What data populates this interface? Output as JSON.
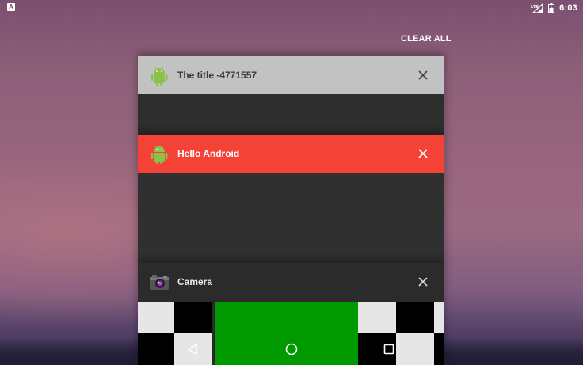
{
  "status_bar": {
    "notification_icon": "A",
    "signal_label": "LTE",
    "time": "6:03"
  },
  "recents": {
    "clear_all_label": "CLEAR ALL",
    "tasks": [
      {
        "title": "The title -4771557",
        "icon": "android-robot-icon",
        "header_color": "#c2c2c2"
      },
      {
        "title": "Hello Android",
        "icon": "android-robot-icon",
        "header_color": "#f44336"
      },
      {
        "title": "Camera",
        "icon": "camera-icon",
        "header_color": "#2b2b2b"
      }
    ]
  },
  "nav_bar": {
    "buttons": [
      "back-icon",
      "home-icon",
      "recents-icon"
    ]
  },
  "colors": {
    "android_green": "#8bc34a",
    "accent_red": "#f44336",
    "preview_green": "#009900"
  }
}
